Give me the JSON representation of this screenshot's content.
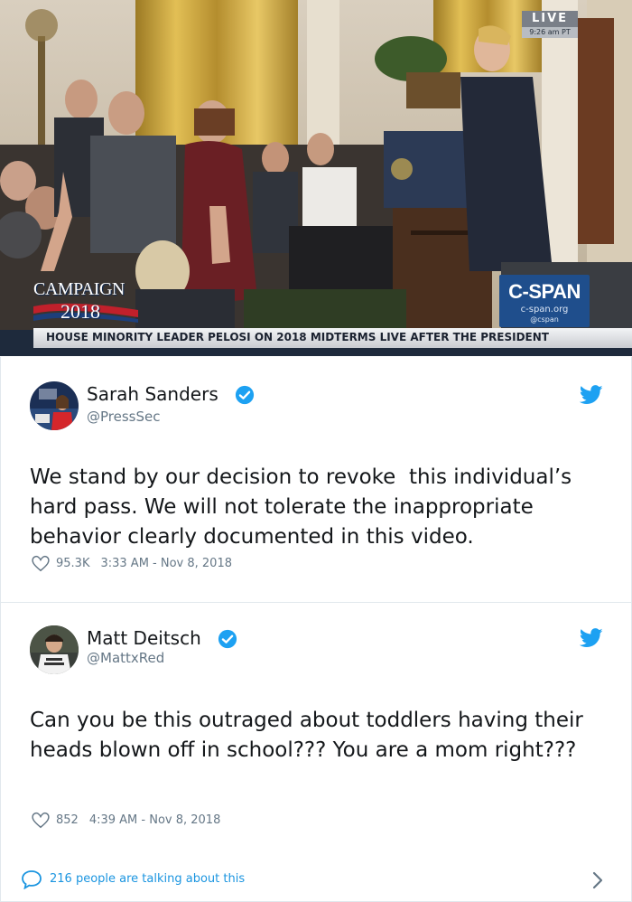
{
  "video": {
    "live_label": "LIVE",
    "live_time": "9:26 am PT",
    "campaign_line1": "CAMPAIGN",
    "campaign_line2": "2018",
    "network_name": "C-SPAN",
    "network_url": "c-span.org",
    "network_handle": "@cspan",
    "lower_third": "HOUSE MINORITY LEADER PELOSI ON 2018 MIDTERMS LIVE AFTER THE PRESIDENT",
    "colors": {
      "cspan_blue": "#1f4e8c",
      "curtain_gold": "#c9a23c"
    }
  },
  "tweets": [
    {
      "display_name": "Sarah Sanders",
      "handle": "@PressSec",
      "verified": true,
      "text": "We stand by our decision to revoke  this individual’s hard pass. We will not tolerate the inappropriate behavior clearly documented in this video.",
      "likes": "95.3K",
      "timestamp": "3:33 AM - Nov 8, 2018",
      "icons": {
        "avatar": "avatar-photo",
        "verified": "verified-badge-icon",
        "brand": "twitter-bird-icon",
        "like": "heart-icon"
      }
    },
    {
      "display_name": "Matt Deitsch",
      "handle": "@MattxRed",
      "verified": true,
      "text": "Can you be this outraged about toddlers having their heads blown off in school??? You are a mom right???",
      "likes": "852",
      "timestamp": "4:39 AM - Nov 8, 2018",
      "icons": {
        "avatar": "avatar-photo",
        "verified": "verified-badge-icon",
        "brand": "twitter-bird-icon",
        "like": "heart-icon"
      }
    }
  ],
  "footer": {
    "talking_text": "216 people are talking about this",
    "icons": {
      "talk": "speech-bubble-icon",
      "more": "chevron-right-icon"
    }
  },
  "colors": {
    "twitter_blue": "#1da1f2",
    "link_blue": "#1b95e0",
    "meta_gray": "#657786",
    "text": "#14171a",
    "border": "#e1e8ed"
  }
}
